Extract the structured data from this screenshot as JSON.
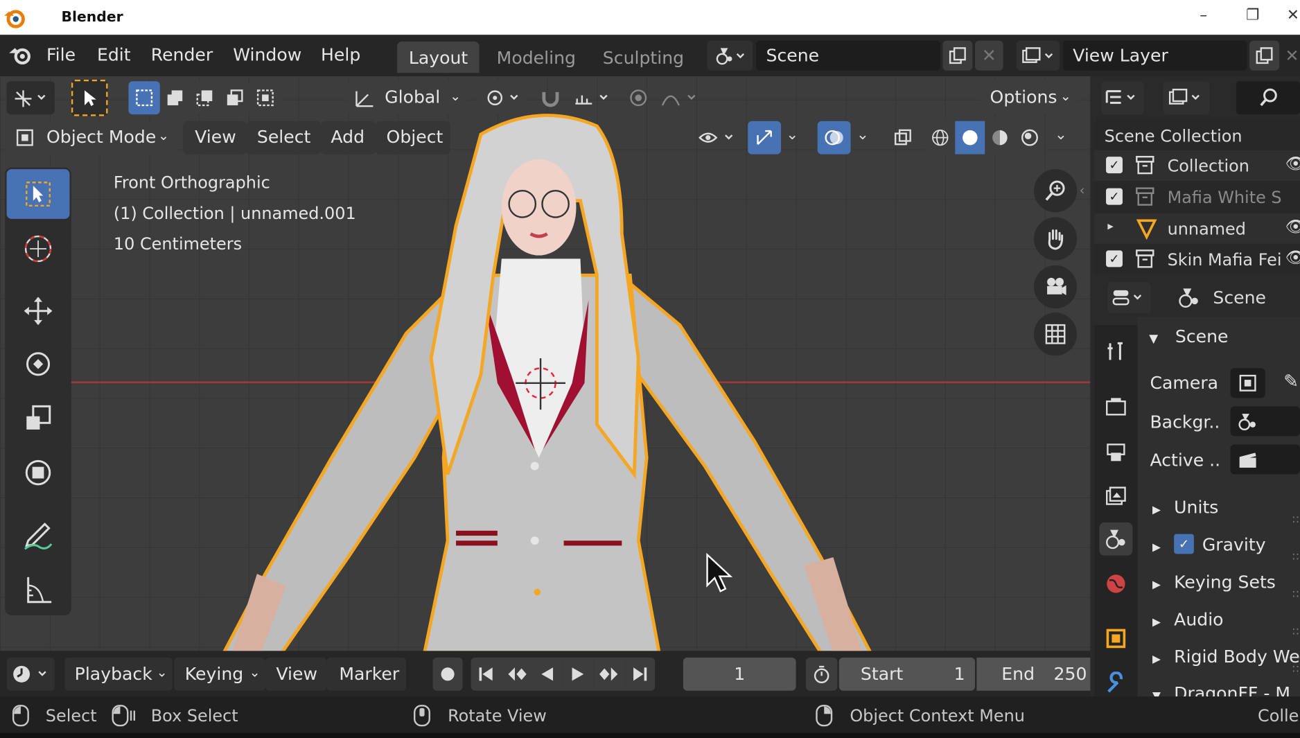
{
  "window": {
    "app_title": "Blender",
    "minimize": "–",
    "maximize": "❐",
    "close": "✕"
  },
  "menu": {
    "items": [
      "File",
      "Edit",
      "Render",
      "Window",
      "Help"
    ]
  },
  "workspace_tabs": [
    {
      "label": "Layout",
      "active": true
    },
    {
      "label": "Modeling",
      "active": false
    },
    {
      "label": "Sculpting",
      "active": false
    }
  ],
  "scene_field": {
    "value": "Scene"
  },
  "view_layer_field": {
    "value": "View Layer"
  },
  "tool_header": {
    "transform_orientation": "Global",
    "options_label": "Options"
  },
  "viewport_header": {
    "mode": "Object Mode",
    "menus": [
      "View",
      "Select",
      "Add",
      "Object"
    ]
  },
  "viewport_overlay": {
    "view_name": "Front Orthographic",
    "collection_info": "(1) Collection | unnamed.001",
    "scale": "10 Centimeters"
  },
  "outliner": {
    "title": "Scene Collection",
    "rows": [
      {
        "label": "Collection",
        "checked": true,
        "dimmed": false
      },
      {
        "label": "Mafia White S",
        "checked": true,
        "dimmed": true
      },
      {
        "label": "unnamed",
        "checked": false,
        "dimmed": false
      },
      {
        "label": "Skin Mafia Fei",
        "checked": true,
        "dimmed": false
      }
    ]
  },
  "properties": {
    "header_label": "Scene",
    "panel_title": "Scene",
    "camera_label": "Camera",
    "background_label": "Backgr..",
    "active_label": "Active ..",
    "sections": [
      "Units",
      "Gravity",
      "Keying Sets",
      "Audio",
      "Rigid Body We",
      "DragonFF - M"
    ],
    "gravity_checked": true
  },
  "timeline": {
    "menus": [
      "Playback",
      "Keying",
      "View",
      "Marker"
    ],
    "current_frame": "1",
    "start_label": "Start",
    "start_value": "1",
    "end_label": "End",
    "end_value": "250"
  },
  "status_bar": {
    "select": "Select",
    "box_select": "Box Select",
    "rotate_view": "Rotate View",
    "context_menu": "Object Context Menu",
    "right_truncated": "Colle"
  },
  "colors": {
    "accent": "#4772b3",
    "selection_outline": "#f5a623",
    "x_axis": "#c43c3c",
    "viewport_bg": "#3d3d3d"
  }
}
